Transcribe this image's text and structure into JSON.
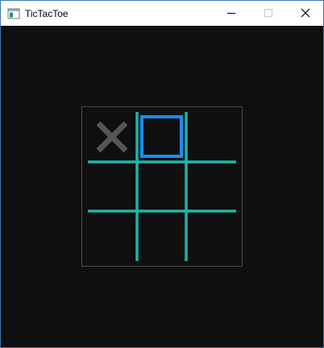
{
  "window": {
    "title": "TicTacToe"
  },
  "titlebar_buttons": {
    "minimize_icon": "minimize-icon",
    "maximize_icon": "maximize-icon",
    "close_icon": "close-icon"
  },
  "game": {
    "board": [
      [
        "X",
        "",
        ""
      ],
      [
        "",
        "",
        ""
      ],
      [
        "",
        "",
        ""
      ]
    ],
    "cursor": {
      "row": 0,
      "col": 1
    },
    "colors": {
      "grid": "#1fb5a8",
      "x_mark": "#555555",
      "cursor": "#1a8cf0",
      "border": "#4a4a4a",
      "background": "#0f0f0f"
    }
  }
}
